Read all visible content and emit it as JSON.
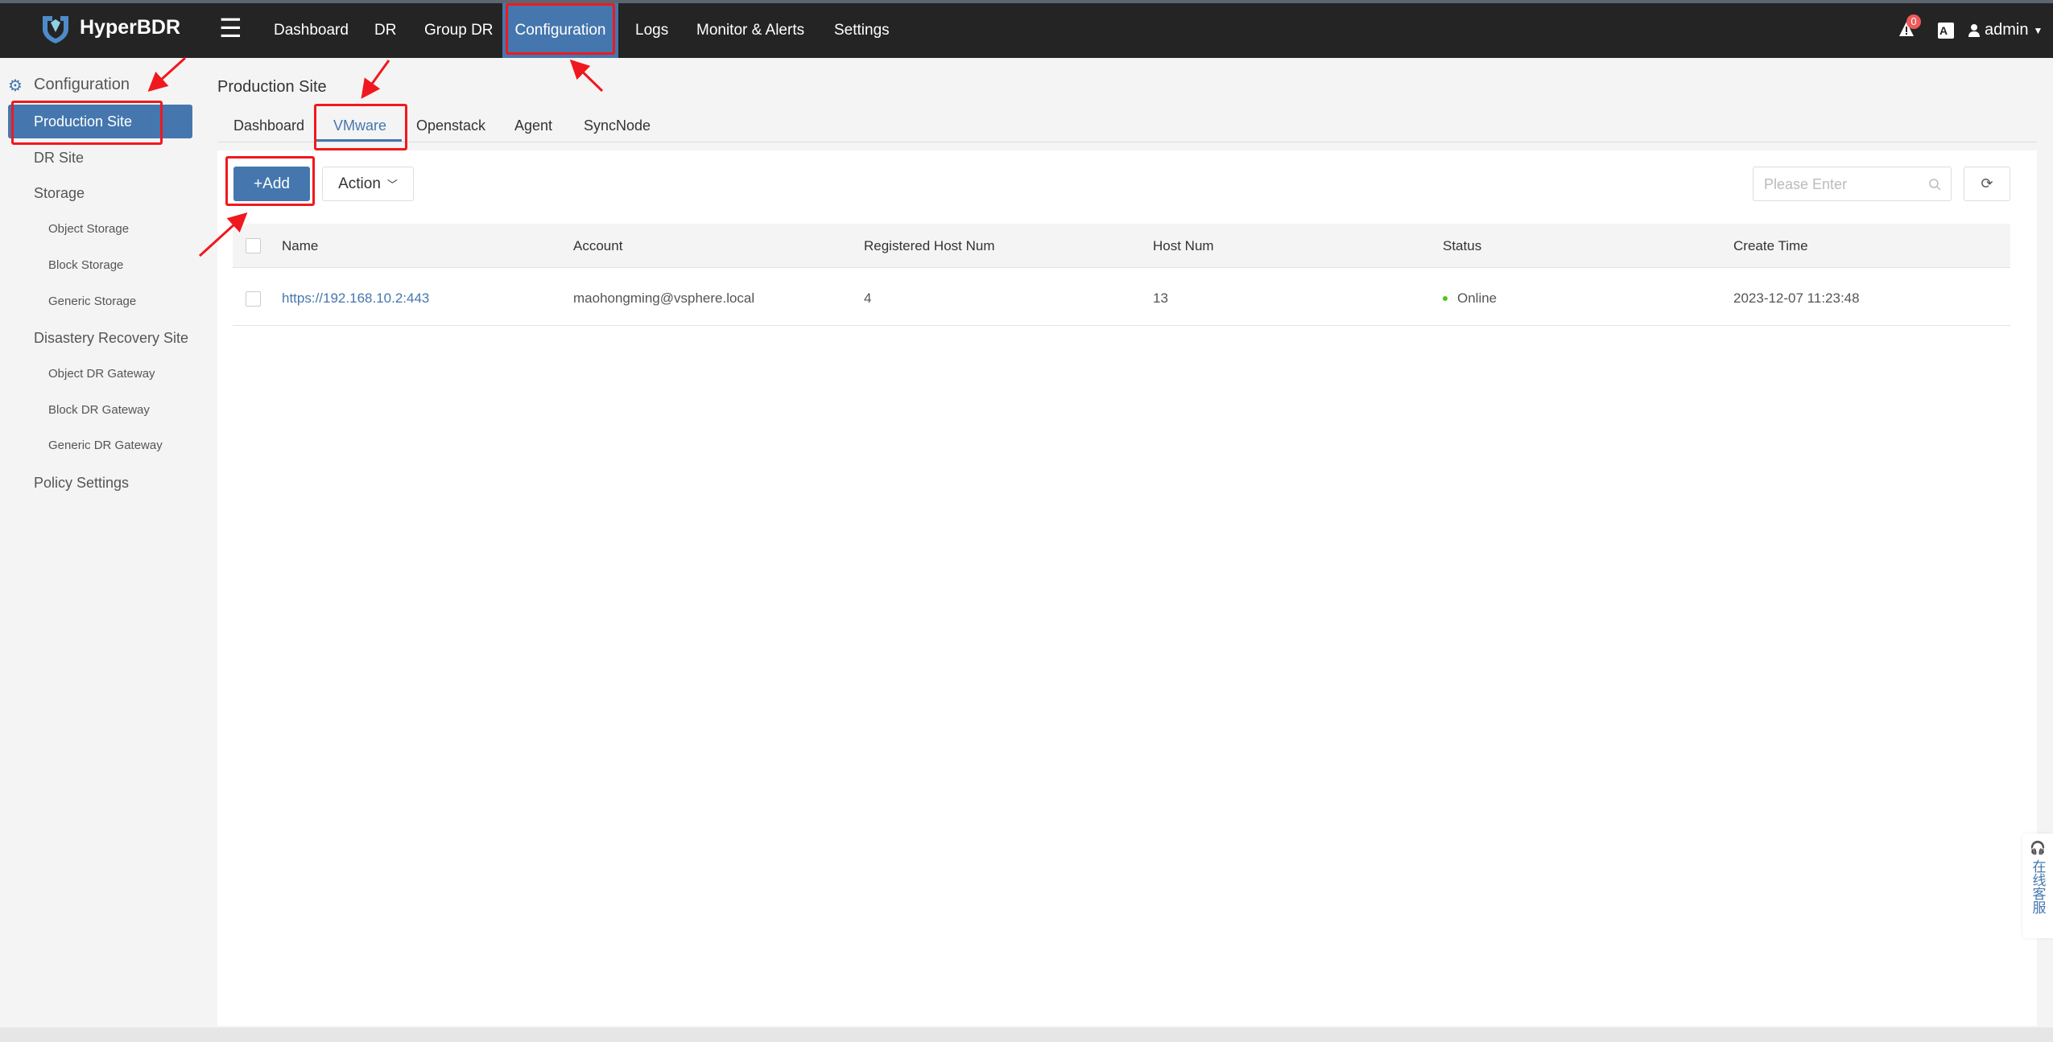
{
  "header": {
    "brand": "HyperBDR",
    "menu_icon": "hamburger-icon",
    "nav": [
      "Dashboard",
      "DR",
      "Group DR",
      "Configuration",
      "Logs",
      "Monitor & Alerts",
      "Settings"
    ],
    "active_nav": "Configuration",
    "alert_count": "0",
    "user": "admin"
  },
  "sidebar": {
    "title": "Configuration",
    "items": [
      {
        "label": "Production Site",
        "active": true
      },
      {
        "label": "DR Site"
      },
      {
        "label": "Storage"
      },
      {
        "label": "Object Storage",
        "sub": true
      },
      {
        "label": "Block Storage",
        "sub": true
      },
      {
        "label": "Generic Storage",
        "sub": true
      },
      {
        "label": "Disastery Recovery Site"
      },
      {
        "label": "Object DR Gateway",
        "sub": true
      },
      {
        "label": "Block DR Gateway",
        "sub": true
      },
      {
        "label": "Generic DR Gateway",
        "sub": true
      },
      {
        "label": "Policy Settings"
      }
    ]
  },
  "main": {
    "title": "Production Site",
    "tabs": [
      "Dashboard",
      "VMware",
      "Openstack",
      "Agent",
      "SyncNode"
    ],
    "active_tab": "VMware",
    "add_label": "+Add",
    "action_label": "Action",
    "search_placeholder": "Please Enter",
    "table": {
      "columns": [
        "Name",
        "Account",
        "Registered Host Num",
        "Host Num",
        "Status",
        "Create Time"
      ],
      "rows": [
        {
          "name": "https://192.168.10.2:443",
          "account": "maohongming@vsphere.local",
          "registered": "4",
          "hosts": "13",
          "status": "Online",
          "created": "2023-12-07 11:23:48"
        }
      ]
    }
  },
  "widget": {
    "label": "在线客服"
  },
  "colors": {
    "accent": "#4577ae",
    "online": "#52c41a",
    "annotation": "#f0181e"
  }
}
